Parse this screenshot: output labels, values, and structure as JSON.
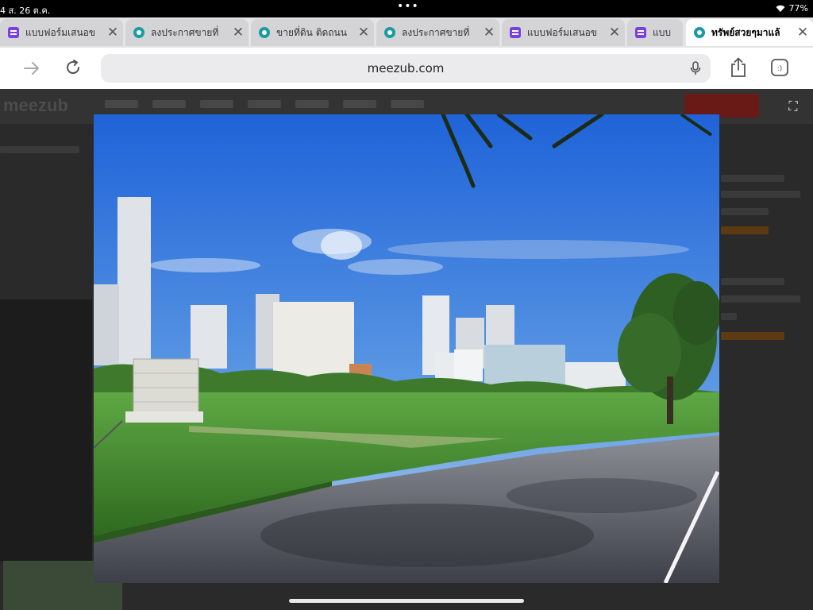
{
  "status": {
    "time": "4  ส. 26 ต.ค.",
    "battery": "77%"
  },
  "tabs": [
    {
      "title": "แบบฟอร์มเสนอข",
      "favicon": "forms-icon",
      "active": false
    },
    {
      "title": "ลงประกาศขายที่",
      "favicon": "site-icon",
      "active": false
    },
    {
      "title": "ขายที่ดิน ติดถนน",
      "favicon": "site-icon",
      "active": false
    },
    {
      "title": "ลงประกาศขายที่",
      "favicon": "site-icon",
      "active": false
    },
    {
      "title": "แบบฟอร์มเสนอข",
      "favicon": "forms-icon",
      "active": false
    },
    {
      "title": "แบบ",
      "favicon": "forms-icon",
      "active": false
    },
    {
      "title": "ทรัพย์สวยๆมาแล้",
      "favicon": "site-icon",
      "active": true
    }
  ],
  "toolbar": {
    "url": "meezub.com"
  },
  "page": {
    "logo": "meezub"
  },
  "colors": {
    "forms_favicon": "#7a3fe0",
    "site_favicon": "#1b9aa6",
    "tabbar_bg": "#e4e4e6",
    "overlay_bg": "#2a2a2a"
  }
}
